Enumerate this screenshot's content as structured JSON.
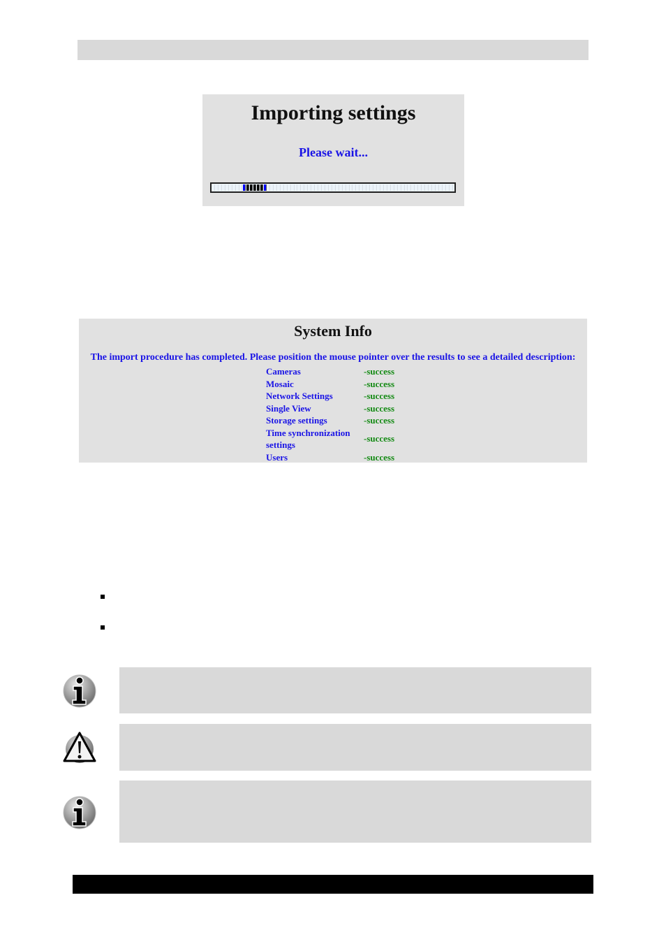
{
  "import_dialog": {
    "title": "Importing settings",
    "status": "Please wait...",
    "progress": {
      "total_segments": 70,
      "active_start": 9,
      "active_count": 7
    },
    "colors": {
      "status_text": "#1a14e6",
      "segment_edge": "#0000ff",
      "segment_active": "#000000"
    }
  },
  "system_info": {
    "title": "System Info",
    "message": "The import procedure has completed. Please position the mouse pointer over the results to see a detailed description:",
    "results": [
      {
        "name": "Cameras",
        "status": "-success"
      },
      {
        "name": "Mosaic",
        "status": "-success"
      },
      {
        "name": "Network Settings",
        "status": "-success"
      },
      {
        "name": "Single View",
        "status": "-success"
      },
      {
        "name": "Storage settings",
        "status": "-success"
      },
      {
        "name": "Time synchronization settings",
        "status": "-success"
      },
      {
        "name": "Users",
        "status": "-success"
      }
    ],
    "colors": {
      "name_text": "#1a14e6",
      "status_text": "#138a13"
    }
  },
  "notes": [
    {
      "icon": "info-icon"
    },
    {
      "icon": "warning-icon"
    },
    {
      "icon": "info-icon"
    }
  ]
}
